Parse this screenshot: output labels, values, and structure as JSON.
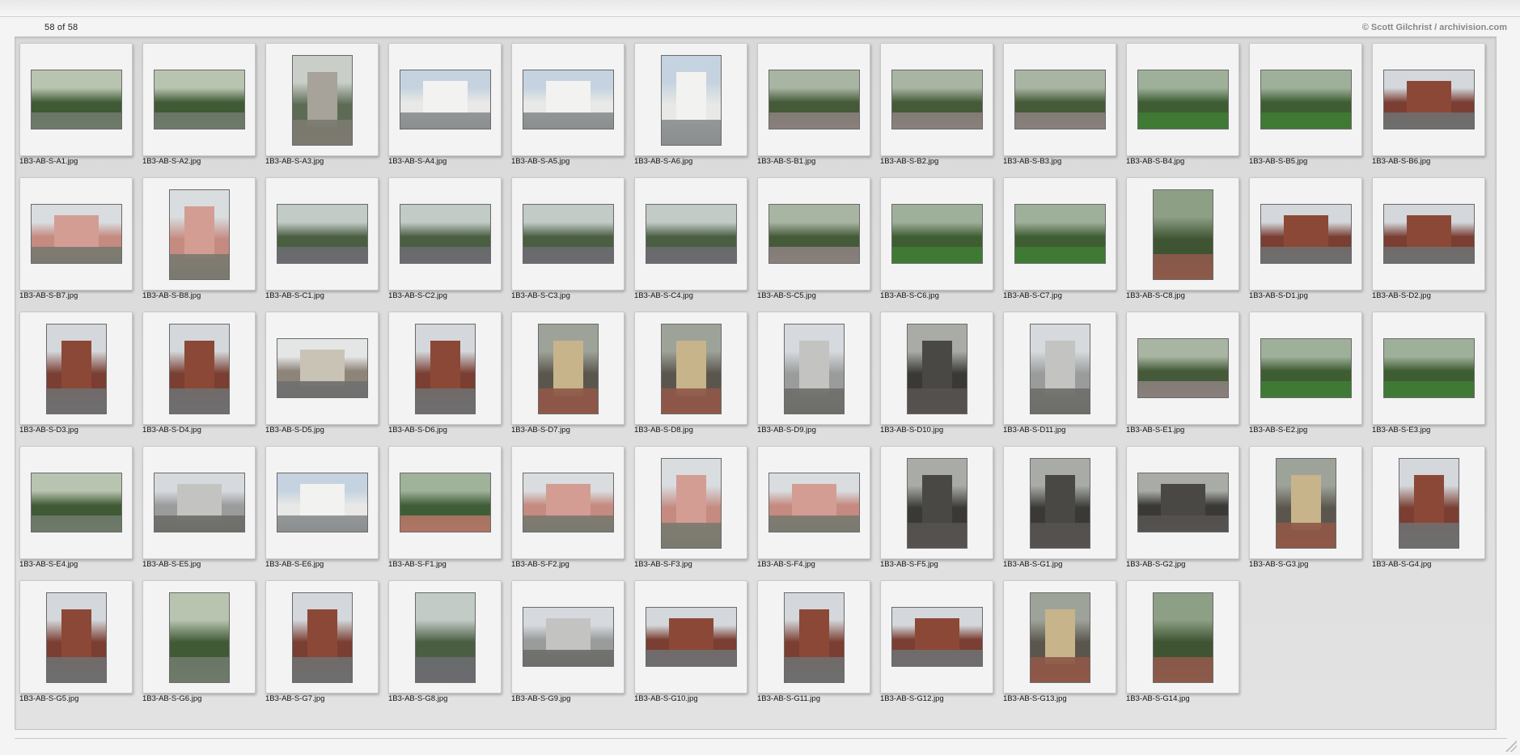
{
  "header": {
    "count_text": "58 of 58",
    "credit_text": "© Scott Gilchrist / archivision.com"
  },
  "colors": {
    "panel": "#dcdcdc",
    "slide": "#f3f3f3"
  },
  "icons": {
    "resize": "resize-grip-icon"
  },
  "thumbnails": [
    {
      "file": "1B3-AB-S-A1.jpg",
      "orientation": "landscape",
      "scene": "park"
    },
    {
      "file": "1B3-AB-S-A2.jpg",
      "orientation": "landscape",
      "scene": "park"
    },
    {
      "file": "1B3-AB-S-A3.jpg",
      "orientation": "portrait",
      "scene": "monument"
    },
    {
      "file": "1B3-AB-S-A4.jpg",
      "orientation": "landscape",
      "scene": "white-building"
    },
    {
      "file": "1B3-AB-S-A5.jpg",
      "orientation": "landscape",
      "scene": "white-building"
    },
    {
      "file": "1B3-AB-S-A6.jpg",
      "orientation": "portrait",
      "scene": "white-building"
    },
    {
      "file": "1B3-AB-S-B1.jpg",
      "orientation": "landscape",
      "scene": "square"
    },
    {
      "file": "1B3-AB-S-B2.jpg",
      "orientation": "landscape",
      "scene": "square"
    },
    {
      "file": "1B3-AB-S-B3.jpg",
      "orientation": "landscape",
      "scene": "square"
    },
    {
      "file": "1B3-AB-S-B4.jpg",
      "orientation": "landscape",
      "scene": "lawn"
    },
    {
      "file": "1B3-AB-S-B5.jpg",
      "orientation": "landscape",
      "scene": "lawn"
    },
    {
      "file": "1B3-AB-S-B6.jpg",
      "orientation": "landscape",
      "scene": "brick"
    },
    {
      "file": "1B3-AB-S-B7.jpg",
      "orientation": "landscape",
      "scene": "pink-house"
    },
    {
      "file": "1B3-AB-S-B8.jpg",
      "orientation": "portrait",
      "scene": "pink-house"
    },
    {
      "file": "1B3-AB-S-C1.jpg",
      "orientation": "landscape",
      "scene": "street"
    },
    {
      "file": "1B3-AB-S-C2.jpg",
      "orientation": "landscape",
      "scene": "street"
    },
    {
      "file": "1B3-AB-S-C3.jpg",
      "orientation": "landscape",
      "scene": "street"
    },
    {
      "file": "1B3-AB-S-C4.jpg",
      "orientation": "landscape",
      "scene": "street"
    },
    {
      "file": "1B3-AB-S-C5.jpg",
      "orientation": "landscape",
      "scene": "square"
    },
    {
      "file": "1B3-AB-S-C6.jpg",
      "orientation": "landscape",
      "scene": "lawn"
    },
    {
      "file": "1B3-AB-S-C7.jpg",
      "orientation": "landscape",
      "scene": "lawn"
    },
    {
      "file": "1B3-AB-S-C8.jpg",
      "orientation": "portrait",
      "scene": "path"
    },
    {
      "file": "1B3-AB-S-D1.jpg",
      "orientation": "landscape",
      "scene": "brick"
    },
    {
      "file": "1B3-AB-S-D2.jpg",
      "orientation": "landscape",
      "scene": "brick"
    },
    {
      "file": "1B3-AB-S-D3.jpg",
      "orientation": "portrait",
      "scene": "brick"
    },
    {
      "file": "1B3-AB-S-D4.jpg",
      "orientation": "portrait",
      "scene": "brick"
    },
    {
      "file": "1B3-AB-S-D5.jpg",
      "orientation": "landscape",
      "scene": "row-houses"
    },
    {
      "file": "1B3-AB-S-D6.jpg",
      "orientation": "portrait",
      "scene": "brick"
    },
    {
      "file": "1B3-AB-S-D7.jpg",
      "orientation": "portrait",
      "scene": "stoop"
    },
    {
      "file": "1B3-AB-S-D8.jpg",
      "orientation": "portrait",
      "scene": "stoop"
    },
    {
      "file": "1B3-AB-S-D9.jpg",
      "orientation": "portrait",
      "scene": "gray-house"
    },
    {
      "file": "1B3-AB-S-D10.jpg",
      "orientation": "portrait",
      "scene": "dark"
    },
    {
      "file": "1B3-AB-S-D11.jpg",
      "orientation": "portrait",
      "scene": "gray-house"
    },
    {
      "file": "1B3-AB-S-E1.jpg",
      "orientation": "landscape",
      "scene": "square"
    },
    {
      "file": "1B3-AB-S-E2.jpg",
      "orientation": "landscape",
      "scene": "lawn"
    },
    {
      "file": "1B3-AB-S-E3.jpg",
      "orientation": "landscape",
      "scene": "lawn"
    },
    {
      "file": "1B3-AB-S-E4.jpg",
      "orientation": "landscape",
      "scene": "park"
    },
    {
      "file": "1B3-AB-S-E5.jpg",
      "orientation": "landscape",
      "scene": "gray-house"
    },
    {
      "file": "1B3-AB-S-E6.jpg",
      "orientation": "landscape",
      "scene": "white-building"
    },
    {
      "file": "1B3-AB-S-F1.jpg",
      "orientation": "landscape",
      "scene": "fountain"
    },
    {
      "file": "1B3-AB-S-F2.jpg",
      "orientation": "landscape",
      "scene": "pink-house"
    },
    {
      "file": "1B3-AB-S-F3.jpg",
      "orientation": "portrait",
      "scene": "pink-house"
    },
    {
      "file": "1B3-AB-S-F4.jpg",
      "orientation": "landscape",
      "scene": "pink-house"
    },
    {
      "file": "1B3-AB-S-F5.jpg",
      "orientation": "portrait",
      "scene": "dark"
    },
    {
      "file": "1B3-AB-S-G1.jpg",
      "orientation": "portrait",
      "scene": "dark"
    },
    {
      "file": "1B3-AB-S-G2.jpg",
      "orientation": "landscape",
      "scene": "dark"
    },
    {
      "file": "1B3-AB-S-G3.jpg",
      "orientation": "portrait",
      "scene": "stoop"
    },
    {
      "file": "1B3-AB-S-G4.jpg",
      "orientation": "portrait",
      "scene": "brick"
    },
    {
      "file": "1B3-AB-S-G5.jpg",
      "orientation": "portrait",
      "scene": "brick"
    },
    {
      "file": "1B3-AB-S-G6.jpg",
      "orientation": "portrait",
      "scene": "park"
    },
    {
      "file": "1B3-AB-S-G7.jpg",
      "orientation": "portrait",
      "scene": "brick"
    },
    {
      "file": "1B3-AB-S-G8.jpg",
      "orientation": "portrait",
      "scene": "street"
    },
    {
      "file": "1B3-AB-S-G9.jpg",
      "orientation": "landscape",
      "scene": "gray-house"
    },
    {
      "file": "1B3-AB-S-G10.jpg",
      "orientation": "landscape",
      "scene": "brick"
    },
    {
      "file": "1B3-AB-S-G11.jpg",
      "orientation": "portrait",
      "scene": "brick"
    },
    {
      "file": "1B3-AB-S-G12.jpg",
      "orientation": "landscape",
      "scene": "brick"
    },
    {
      "file": "1B3-AB-S-G13.jpg",
      "orientation": "portrait",
      "scene": "stoop"
    },
    {
      "file": "1B3-AB-S-G14.jpg",
      "orientation": "portrait",
      "scene": "path"
    }
  ]
}
